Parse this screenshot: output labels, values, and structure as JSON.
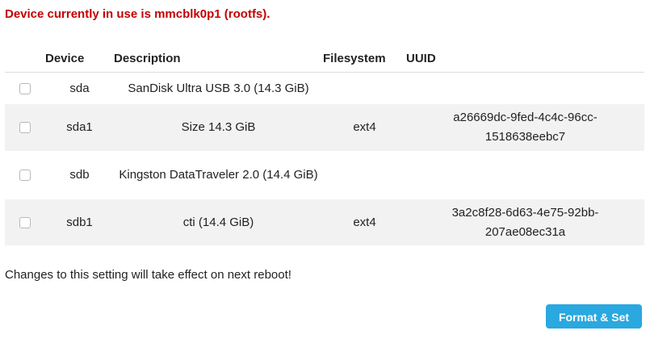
{
  "warning": "Device currently in use is mmcblk0p1 (rootfs).",
  "table": {
    "headers": {
      "device": "Device",
      "description": "Description",
      "filesystem": "Filesystem",
      "uuid": "UUID"
    },
    "rows": [
      {
        "device": "sda",
        "description": "SanDisk Ultra USB 3.0 (14.3 GiB)",
        "filesystem": "",
        "uuid": "",
        "checked": false
      },
      {
        "device": "sda1",
        "description": "Size 14.3 GiB",
        "filesystem": "ext4",
        "uuid": "a26669dc-9fed-4c4c-96cc-1518638eebc7",
        "checked": false
      },
      {
        "device": "sdb",
        "description": "Kingston DataTraveler 2.0 (14.4 GiB)",
        "filesystem": "",
        "uuid": "",
        "checked": false
      },
      {
        "device": "sdb1",
        "description": "cti (14.4 GiB)",
        "filesystem": "ext4",
        "uuid": "3a2c8f28-6d63-4e75-92bb-207ae08ec31a",
        "checked": false
      }
    ]
  },
  "note": "Changes to this setting will take effect on next reboot!",
  "button": {
    "label": "Format & Set"
  },
  "colors": {
    "warning": "#c40000",
    "button": "#2aa8e0",
    "stripe": "#f2f2f2"
  }
}
